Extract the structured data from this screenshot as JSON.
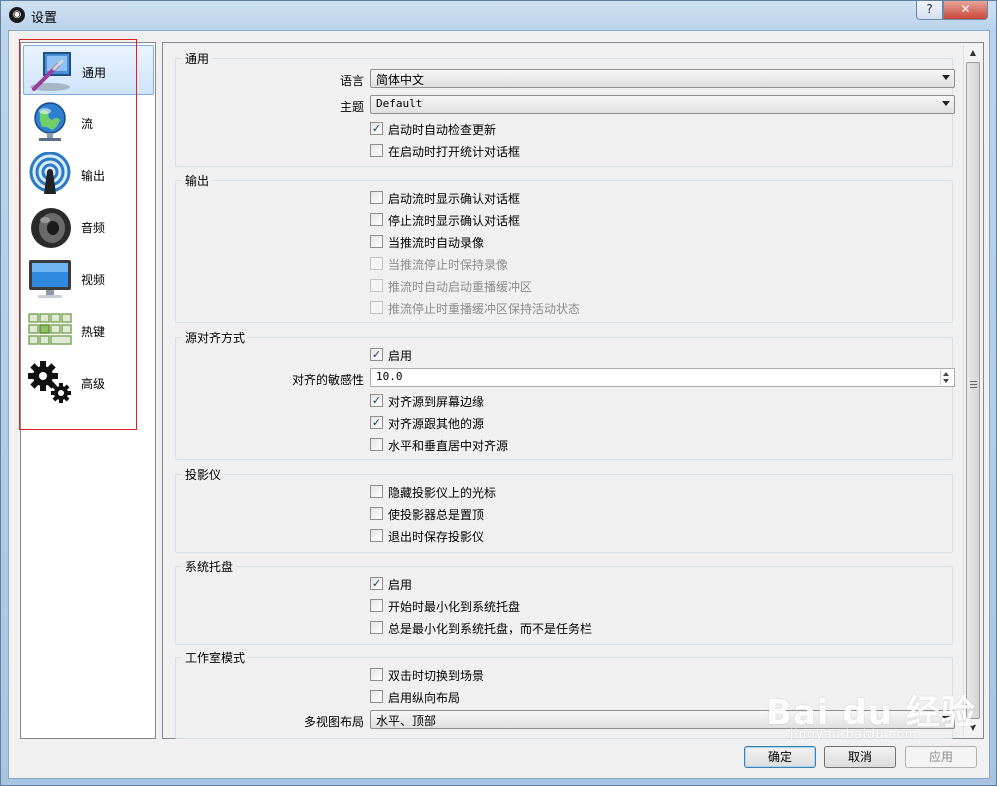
{
  "window": {
    "title": "设置",
    "help_label": "?",
    "close_label": "✕"
  },
  "sidebar": {
    "items": [
      {
        "label": "通用",
        "icon": "general-settings-icon",
        "selected": true
      },
      {
        "label": "流",
        "icon": "stream-globe-icon",
        "selected": false
      },
      {
        "label": "输出",
        "icon": "output-broadcast-icon",
        "selected": false
      },
      {
        "label": "音频",
        "icon": "audio-speaker-icon",
        "selected": false
      },
      {
        "label": "视频",
        "icon": "video-monitor-icon",
        "selected": false
      },
      {
        "label": "热键",
        "icon": "hotkeys-keyboard-icon",
        "selected": false
      },
      {
        "label": "高级",
        "icon": "advanced-gears-icon",
        "selected": false
      }
    ]
  },
  "groups": {
    "general": {
      "title": "通用",
      "language_label": "语言",
      "language_value": "简体中文",
      "theme_label": "主题",
      "theme_value": "Default",
      "check_updates": {
        "label": "启动时自动检查更新",
        "checked": true
      },
      "open_stats": {
        "label": "在启动时打开统计对话框",
        "checked": false
      }
    },
    "output": {
      "title": "输出",
      "items": [
        {
          "label": "启动流时显示确认对话框",
          "checked": false,
          "enabled": true
        },
        {
          "label": "停止流时显示确认对话框",
          "checked": false,
          "enabled": true
        },
        {
          "label": "当推流时自动录像",
          "checked": false,
          "enabled": true
        },
        {
          "label": "当推流停止时保持录像",
          "checked": false,
          "enabled": false
        },
        {
          "label": "推流时自动启动重播缓冲区",
          "checked": false,
          "enabled": false
        },
        {
          "label": "推流停止时重播缓冲区保持活动状态",
          "checked": false,
          "enabled": false
        }
      ]
    },
    "snapping": {
      "title": "源对齐方式",
      "enable": {
        "label": "启用",
        "checked": true
      },
      "sensitivity_label": "对齐的敏感性",
      "sensitivity_value": "10.0",
      "screen_edge": {
        "label": "对齐源到屏幕边缘",
        "checked": true
      },
      "other_sources": {
        "label": "对齐源跟其他的源",
        "checked": true
      },
      "center": {
        "label": "水平和垂直居中对齐源",
        "checked": false
      }
    },
    "projector": {
      "title": "投影仪",
      "items": [
        {
          "label": "隐藏投影仪上的光标",
          "checked": false
        },
        {
          "label": "使投影器总是置顶",
          "checked": false
        },
        {
          "label": "退出时保存投影仪",
          "checked": false
        }
      ]
    },
    "tray": {
      "title": "系统托盘",
      "items": [
        {
          "label": "启用",
          "checked": true
        },
        {
          "label": "开始时最小化到系统托盘",
          "checked": false
        },
        {
          "label": "总是最小化到系统托盘，而不是任务栏",
          "checked": false
        }
      ]
    },
    "studio": {
      "title": "工作室模式",
      "items": [
        {
          "label": "双击时切换到场景",
          "checked": false
        },
        {
          "label": "启用纵向布局",
          "checked": false
        }
      ],
      "multiview_label": "多视图布局",
      "multiview_value": "水平、顶部"
    }
  },
  "buttons": {
    "ok": "确定",
    "cancel": "取消",
    "apply": "应用"
  },
  "watermark": {
    "main": "Bai du 经验",
    "sub": "jingyan.baidu.com"
  },
  "check_mark": "✓",
  "colors": {
    "accent": "#3c7fb1",
    "highlight_box": "#e02020",
    "selected_item": "#cfe4fb"
  }
}
